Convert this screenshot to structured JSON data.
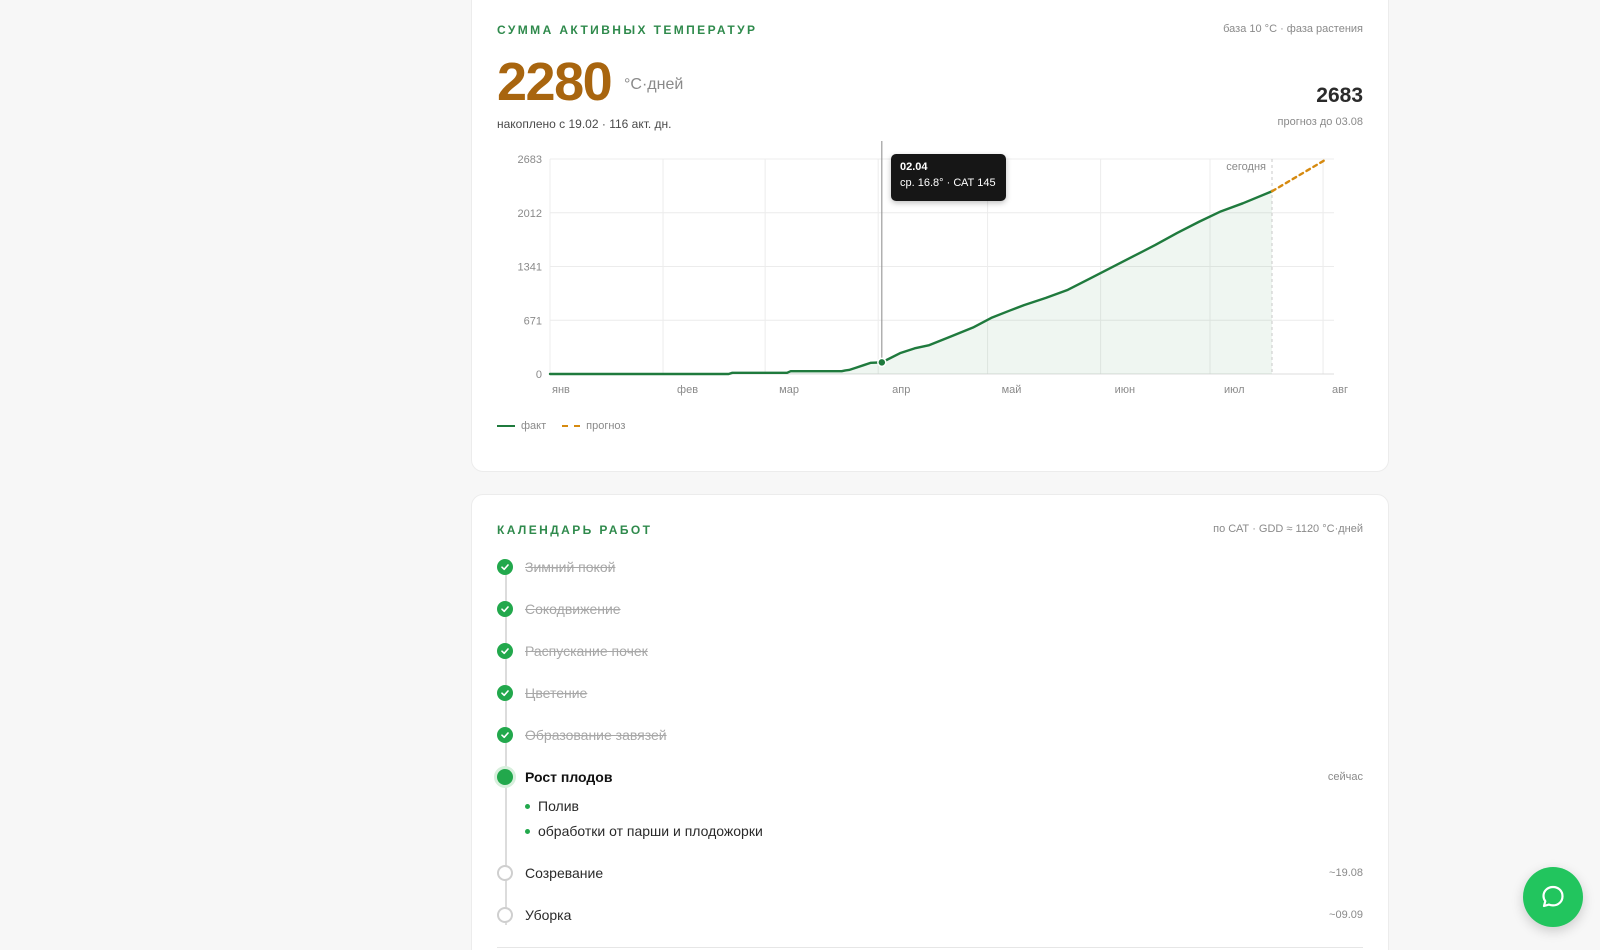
{
  "gdd": {
    "title": "СУММА АКТИВНЫХ ТЕМПЕРАТУР",
    "meta": "база 10 °С · фаза растения",
    "value": "2280",
    "unit": "°С·дней",
    "accumulated": "накоплено с 19.02 · 116 акт. дн.",
    "forecast_value": "2683",
    "forecast_label": "прогноз до 03.08"
  },
  "tooltip": {
    "date": "02.04",
    "info": "ср. 16.8° · САТ 145"
  },
  "legend": {
    "fact": "факт",
    "forecast": "прогноз"
  },
  "colors": {
    "accent": "#2f8a4c",
    "fact_line": "#1f7a3d",
    "forecast_line": "#d68a10",
    "value": "#a8650f",
    "done": "#22a84c",
    "fab": "#22c55e"
  },
  "chart_data": {
    "type": "line",
    "ylim": [
      0,
      2683
    ],
    "y_ticks": [
      "0",
      "671",
      "1341",
      "2012",
      "2683"
    ],
    "x_tick_labels": [
      "янв",
      "фев",
      "мар",
      "апр",
      "май",
      "июн",
      "июл",
      "авг"
    ],
    "xlim": [
      0,
      215
    ],
    "month_starts": [
      0,
      31,
      59,
      90,
      120,
      151,
      181,
      212
    ],
    "today_label": "сегодня",
    "today_day": 198,
    "hover_day": 91,
    "series": [
      {
        "name": "факт",
        "style": "solid",
        "x": [
          0,
          49,
          50,
          65,
          66,
          80,
          81,
          82,
          84,
          86,
          88,
          91,
          96,
          100,
          104,
          110,
          116,
          121,
          126,
          130,
          136,
          142,
          148,
          154,
          160,
          166,
          172,
          178,
          184,
          190,
          198
        ],
        "y": [
          0,
          0,
          15,
          15,
          35,
          35,
          45,
          50,
          80,
          110,
          140,
          145,
          260,
          320,
          360,
          470,
          580,
          700,
          790,
          860,
          950,
          1050,
          1190,
          1330,
          1470,
          1610,
          1760,
          1900,
          2030,
          2130,
          2280
        ]
      },
      {
        "name": "прогноз",
        "style": "dashed",
        "x": [
          198,
          213
        ],
        "y": [
          2280,
          2683
        ]
      }
    ]
  },
  "calendar": {
    "title": "КАЛЕНДАРЬ РАБОТ",
    "meta": "по САТ · GDD ≈ 1120 °С·дней",
    "phases": [
      {
        "label": "Зимний покой",
        "state": "done",
        "when": ""
      },
      {
        "label": "Сокодвижение",
        "state": "done",
        "when": ""
      },
      {
        "label": "Распускание почек",
        "state": "done",
        "when": ""
      },
      {
        "label": "Цветение",
        "state": "done",
        "when": ""
      },
      {
        "label": "Образование завязей",
        "state": "done",
        "when": ""
      },
      {
        "label": "Рост плодов",
        "state": "current",
        "when": "сейчас"
      },
      {
        "label": "Созревание",
        "state": "todo",
        "when": "~19.08"
      },
      {
        "label": "Уборка",
        "state": "todo",
        "when": "~09.09"
      }
    ],
    "tasks": [
      "Полив",
      "обработки от парши и плодожорки"
    ]
  },
  "fab": {
    "icon": "chat-bubble-icon"
  }
}
